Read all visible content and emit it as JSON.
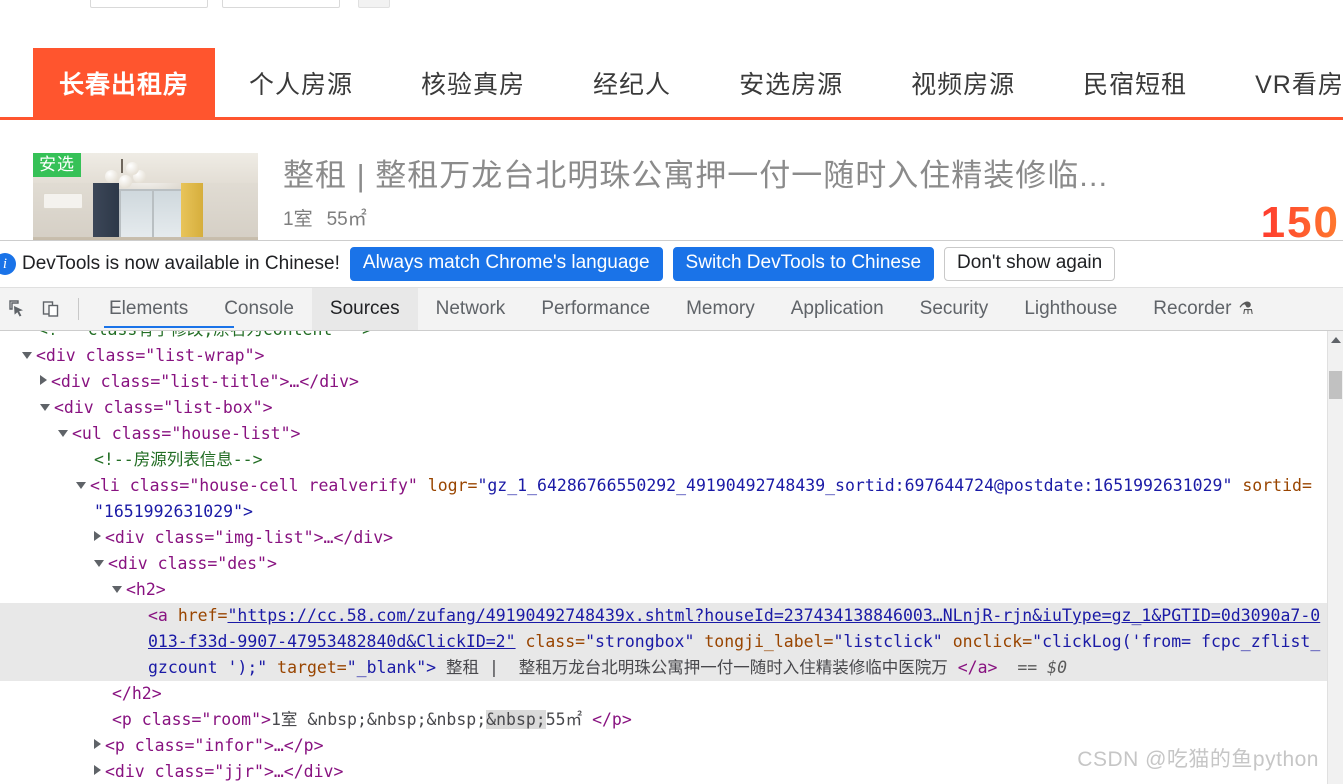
{
  "webpage": {
    "nav_tabs": [
      {
        "label": "长春出租房",
        "active": true
      },
      {
        "label": "个人房源",
        "active": false
      },
      {
        "label": "核验真房",
        "active": false
      },
      {
        "label": "经纪人",
        "active": false
      },
      {
        "label": "安选房源",
        "active": false
      },
      {
        "label": "视频房源",
        "active": false
      },
      {
        "label": "民宿短租",
        "active": false
      },
      {
        "label": "VR看房",
        "active": false
      }
    ],
    "accent_color": "#ff552e",
    "listing": {
      "badge": "安选",
      "badge_color": "#36c157",
      "title": "整租 | 整租万龙台北明珠公寓押一付一随时入住精装修临...",
      "rooms": "1室",
      "area": "55㎡",
      "price": "150"
    }
  },
  "devtools": {
    "notice": {
      "icon": "info-icon",
      "message": "DevTools is now available in Chinese!",
      "button_always_match": "Always match Chrome's language",
      "button_switch": "Switch DevTools to Chinese",
      "button_dismiss": "Don't show again",
      "primary_color": "#1a73e8"
    },
    "toolbar_icons": [
      {
        "name": "inspect-element-icon"
      },
      {
        "name": "device-toolbar-icon"
      }
    ],
    "tabs": [
      {
        "label": "Elements",
        "active": false
      },
      {
        "label": "Console",
        "active": false
      },
      {
        "label": "Sources",
        "active": true
      },
      {
        "label": "Network",
        "active": false
      },
      {
        "label": "Performance",
        "active": false
      },
      {
        "label": "Memory",
        "active": false
      },
      {
        "label": "Application",
        "active": false
      },
      {
        "label": "Security",
        "active": false
      },
      {
        "label": "Lighthouse",
        "active": false
      },
      {
        "label": "Recorder",
        "active": false,
        "badge": "⚗"
      }
    ],
    "dom": {
      "line_comment_top": "<!-- class有了修改,原名为content -->",
      "l_listwrap": "<div class=\"list-wrap\">",
      "l_listtitle_tag": "<div class=\"list-title\">",
      "l_listtitle_rest": "…</div>",
      "l_listbox": "<div class=\"list-box\">",
      "l_houselist": "<ul class=\"house-list\">",
      "l_comment_house": "<!--房源列表信息-->",
      "li_open": "<li class=\"house-cell realverify\"",
      "li_attr_logr_name": "logr=",
      "li_attr_logr_value": "\"gz_1_64286766550292_49190492748439_sortid:697644724@postdate:1651992631029\"",
      "li_attr_sortid_name": "sortid=",
      "li_attr_sortid_value": "\"1651992631029\">",
      "l_imglist": "<div class=\"img-list\">…</div>",
      "l_des": "<div class=\"des\">",
      "l_h2_open": "<h2>",
      "a_tag": "<a ",
      "a_href_name": "href=",
      "a_href_line1": "\"https://cc.58.com/zufang/49190492748439x.shtml?houseId=237434138846003…NLnjR-rjn&iuType=gz_1&PGTID=0d3090a7-0",
      "a_href_line2": "013-f33d-9907-47953482840d&ClickID=2\"",
      "a_class_name": "class=",
      "a_class_value": "\"strongbox\"",
      "a_tongji_name": "tongji_label=",
      "a_tongji_value": "\"listclick\"",
      "a_onclick_name": "onclick=",
      "a_onclick_value_1": "\"clickLog('from= fcpc_zflist_",
      "a_onclick_value_2": "gzcount ');\"",
      "a_target_name": "target=",
      "a_target_value": "\"_blank\">",
      "a_text": " 整租 |  整租万龙台北明珠公寓押一付一随时入住精装修临中医院万 ",
      "a_close": "</a>",
      "selected_marker": "== $0",
      "l_h2_close": "</h2>",
      "p_room_open": "<p class=\"room\">",
      "p_room_text_1": "1室 &nbsp;&nbsp;&nbsp;",
      "p_room_text_2": "&nbsp;",
      "p_room_text_3": "55㎡ ",
      "p_room_close": "</p>",
      "l_infor": "<p class=\"infor\">…</p>",
      "l_jjr": "<div class=\"jjr\">…</div>"
    }
  },
  "watermark": "CSDN @吃猫的鱼python"
}
